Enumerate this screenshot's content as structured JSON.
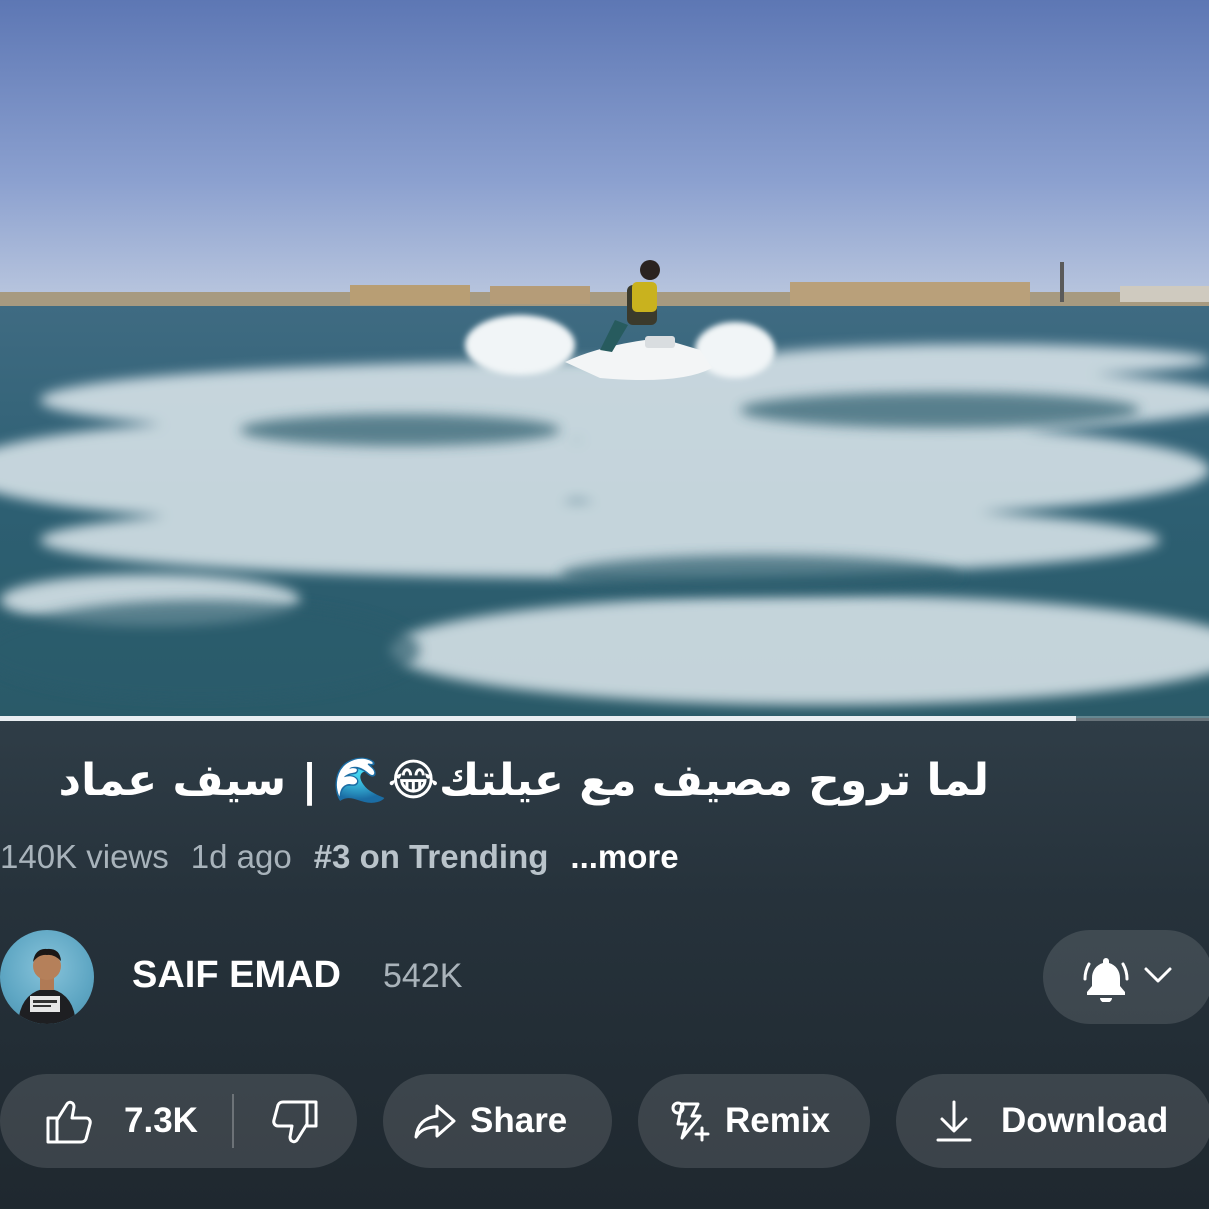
{
  "video": {
    "progress": 0.89
  },
  "title": "لما تروح مصيف مع عيلتك😂🌊 | سيف عماد",
  "meta": {
    "views": "140K views",
    "age": "1d ago",
    "trending": "#3 on Trending",
    "more": "...more"
  },
  "channel": {
    "name": "SAIF EMAD",
    "subscribers": "542K"
  },
  "actions": {
    "likes": "7.3K",
    "share": "Share",
    "remix": "Remix",
    "download": "Download"
  },
  "icons": [
    "bell-icon",
    "chevron-down-icon",
    "thumbs-up-icon",
    "thumbs-down-icon",
    "share-icon",
    "remix-icon",
    "download-icon"
  ],
  "colors": {
    "background": "#2f3d47",
    "pill": "#46525b",
    "text_secondary": "#a8b3bb"
  }
}
